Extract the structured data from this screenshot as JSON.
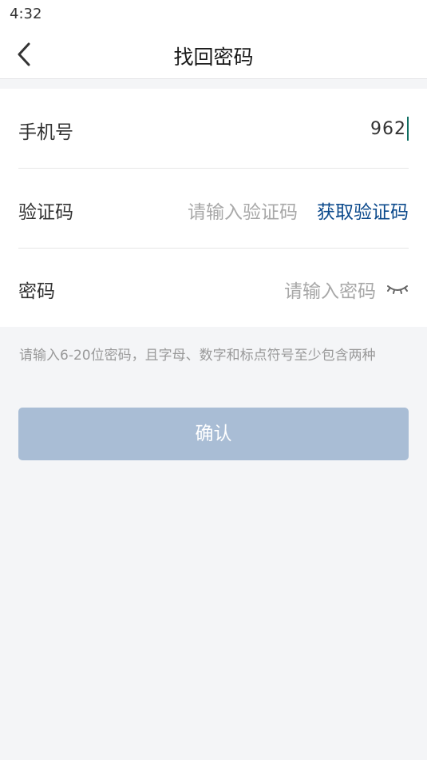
{
  "status_bar": {
    "time": "4:32"
  },
  "header": {
    "title": "找回密码",
    "back_icon": "chevron-left-icon"
  },
  "form": {
    "phone": {
      "label": "手机号",
      "value": "962"
    },
    "code": {
      "label": "验证码",
      "placeholder": "请输入验证码",
      "get_code_label": "获取验证码"
    },
    "password": {
      "label": "密码",
      "placeholder": "请输入密码",
      "toggle_icon": "eye-closed-icon"
    }
  },
  "hint": "请输入6-20位密码，且字母、数字和标点符号至少包含两种",
  "confirm_label": "确认",
  "colors": {
    "accent_link": "#0c4a8c",
    "button_disabled": "#a9bdd5",
    "cursor": "#0f6e62",
    "background": "#f4f5f7"
  }
}
